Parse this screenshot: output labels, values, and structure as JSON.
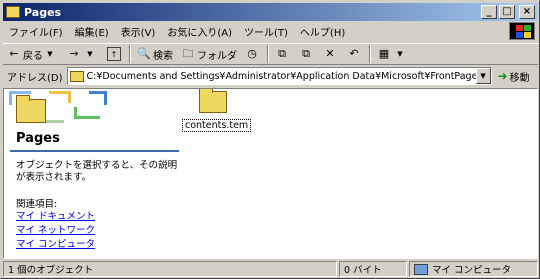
{
  "window": {
    "title": "Pages"
  },
  "title_buttons": {
    "minimize": "_",
    "maximize": "□",
    "close": "×"
  },
  "menu": [
    "ファイル(F)",
    "編集(E)",
    "表示(V)",
    "お気に入り(A)",
    "ツール(T)",
    "ヘルプ(H)"
  ],
  "toolbar": {
    "back_label": "戻る",
    "search_label": "検索",
    "folders_label": "フォルダ"
  },
  "address": {
    "label": "アドレス(D)",
    "value": "C:¥Documents and Settings¥Administrator¥Application Data¥Microsoft¥FrontPage¥Pages",
    "go_label": "移動"
  },
  "webview": {
    "title": "Pages",
    "description": "オブジェクトを選択すると、その説明が表示されます。",
    "related_label": "関連項目:",
    "links": [
      "マイ ドキュメント",
      "マイ ネットワーク",
      "マイ コンピュータ"
    ]
  },
  "files": [
    {
      "name": "contents.tem",
      "icon": "folder-icon"
    }
  ],
  "status": {
    "count": "1 個のオブジェクト",
    "size": "0 バイト",
    "zone": "マイ コンピュータ"
  },
  "colors": {
    "title_start": "#0a246a",
    "title_end": "#a6caf0",
    "link": "#0000ee",
    "accent_line": "#3a6ea5"
  }
}
